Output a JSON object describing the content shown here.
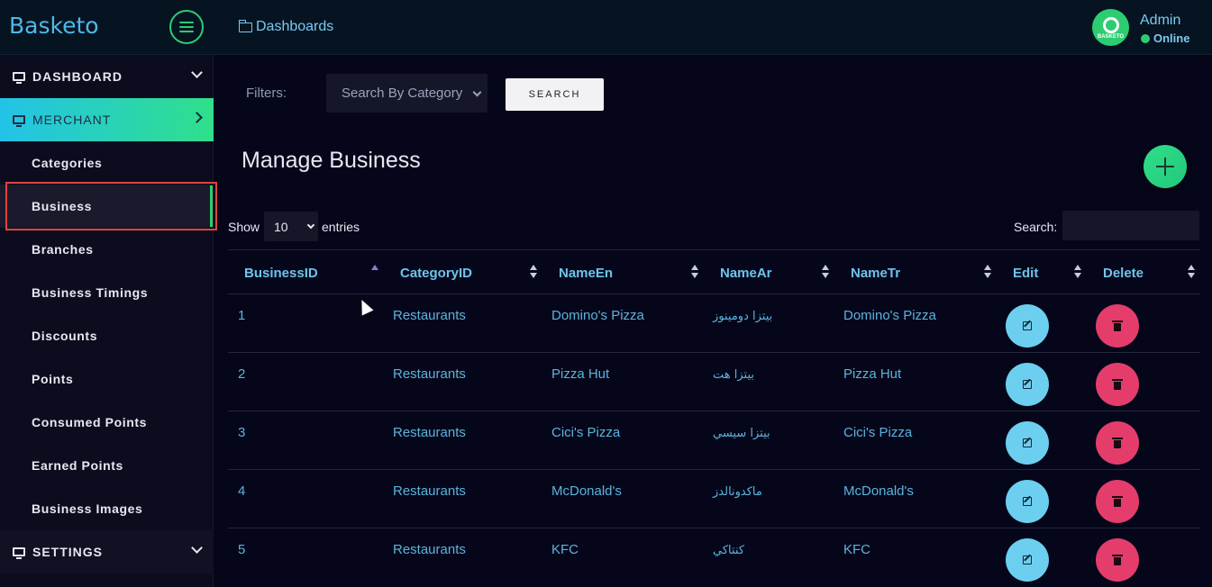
{
  "header": {
    "brand": "Basketo",
    "breadcrumb": "Dashboards",
    "user": {
      "name": "Admin",
      "status": "Online",
      "avatar_text": "BASKETO"
    }
  },
  "sidebar": {
    "dashboard": "DASHBOARD",
    "merchant": "MERCHANT",
    "settings": "SETTINGS",
    "items": [
      {
        "label": "Categories"
      },
      {
        "label": "Business"
      },
      {
        "label": "Branches"
      },
      {
        "label": "Business Timings"
      },
      {
        "label": "Discounts"
      },
      {
        "label": "Points"
      },
      {
        "label": "Consumed Points"
      },
      {
        "label": "Earned Points"
      },
      {
        "label": "Business Images"
      }
    ]
  },
  "filters": {
    "label": "Filters:",
    "category_select": "Search By Category",
    "search_button": "SEARCH"
  },
  "page": {
    "title": "Manage Business",
    "show_label": "Show",
    "entries_value": "10",
    "entries_label": "entries",
    "search_label": "Search:"
  },
  "table": {
    "columns": [
      "BusinessID",
      "CategoryID",
      "NameEn",
      "NameAr",
      "NameTr",
      "Edit",
      "Delete"
    ],
    "rows": [
      {
        "id": "1",
        "category": "Restaurants",
        "name_en": "Domino's Pizza",
        "name_ar": "بيتزا دومينوز",
        "name_tr": "Domino's Pizza"
      },
      {
        "id": "2",
        "category": "Restaurants",
        "name_en": "Pizza Hut",
        "name_ar": "بيتزا هت",
        "name_tr": "Pizza Hut"
      },
      {
        "id": "3",
        "category": "Restaurants",
        "name_en": "Cici's Pizza",
        "name_ar": "بيتزا سيسي",
        "name_tr": "Cici's Pizza"
      },
      {
        "id": "4",
        "category": "Restaurants",
        "name_en": "McDonald's",
        "name_ar": "ماكدونالدز",
        "name_tr": "McDonald's"
      },
      {
        "id": "5",
        "category": "Restaurants",
        "name_en": "KFC",
        "name_ar": "كنتاكي",
        "name_tr": "KFC"
      }
    ]
  },
  "colors": {
    "accent_green": "#2ecc71",
    "accent_blue": "#4fb8e8",
    "edit_button": "#6ccfef",
    "delete_button": "#e43d6c",
    "highlight_box": "#e0443c"
  },
  "icons": {
    "menu": "hamburger-icon",
    "breadcrumb": "folder-icon",
    "sections": "monitor-icon",
    "edit": "pencil-icon",
    "delete": "trash-icon",
    "add": "plus-icon"
  }
}
